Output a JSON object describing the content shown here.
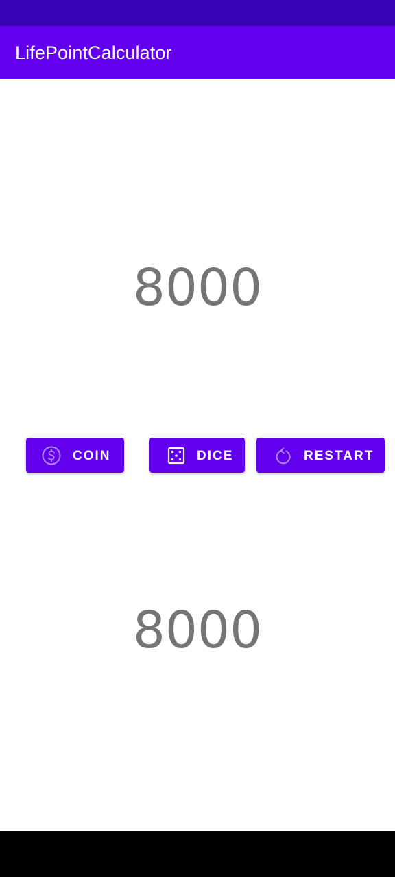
{
  "app": {
    "title": "LifePointCalculator"
  },
  "players": {
    "top_life_points": "8000",
    "bottom_life_points": "8000"
  },
  "buttons": {
    "coin": {
      "label": "COIN",
      "icon": "coin-icon"
    },
    "dice": {
      "label": "DICE",
      "icon": "dice-icon"
    },
    "restart": {
      "label": "RESTART",
      "icon": "restart-icon"
    }
  },
  "colors": {
    "primary": "#6200EE",
    "primary_dark": "#3700B3",
    "life_points_text": "#757575",
    "icon_tint": "#B388FF"
  }
}
